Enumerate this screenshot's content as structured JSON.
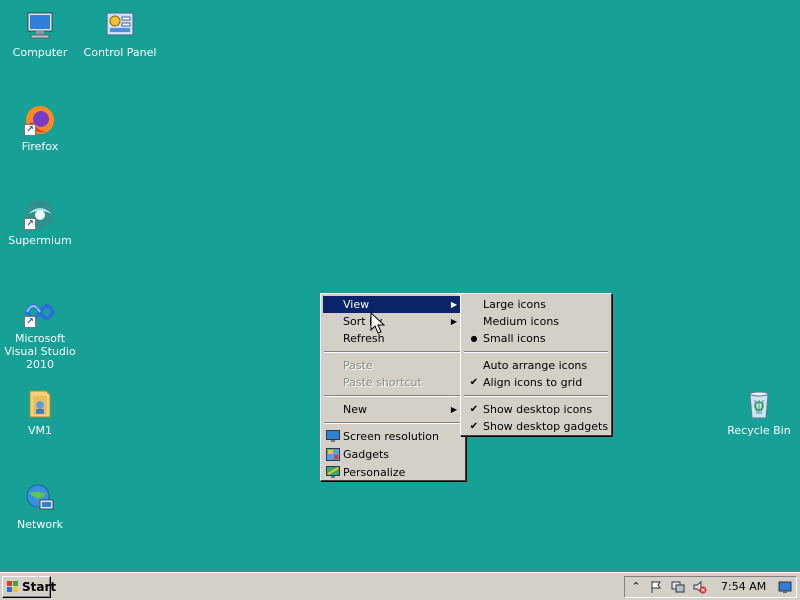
{
  "desktop": {
    "icons": [
      {
        "label": "Computer"
      },
      {
        "label": "Control Panel"
      },
      {
        "label": "Firefox"
      },
      {
        "label": "Supermium"
      },
      {
        "label": "Microsoft Visual Studio 2010"
      },
      {
        "label": "VM1"
      },
      {
        "label": "Network"
      },
      {
        "label": "Recycle Bin"
      }
    ],
    "background_color": "#16a096"
  },
  "context_menu": {
    "items": {
      "view": "View",
      "sort_by": "Sort by",
      "refresh": "Refresh",
      "paste": "Paste",
      "paste_shortcut": "Paste shortcut",
      "new": "New",
      "screen_resolution": "Screen resolution",
      "gadgets": "Gadgets",
      "personalize": "Personalize"
    },
    "selected": "View"
  },
  "view_submenu": {
    "large_icons": "Large icons",
    "medium_icons": "Medium icons",
    "small_icons": "Small icons",
    "auto_arrange": "Auto arrange icons",
    "align_to_grid": "Align icons to grid",
    "show_desktop_icons": "Show desktop icons",
    "show_desktop_gadgets": "Show desktop gadgets",
    "radio_selected": "Small icons",
    "checked": [
      "Align icons to grid",
      "Show desktop icons",
      "Show desktop gadgets"
    ],
    "bullet_glyph": "●",
    "check_glyph": "✔"
  },
  "taskbar": {
    "start_label": "Start",
    "clock": "7:54 AM",
    "tray_icons": [
      "show-hidden-icons",
      "action-center-flag",
      "network-icon",
      "volume-muted-icon",
      "show-desktop-icon"
    ]
  },
  "colors": {
    "menu_highlight": "#0a246a",
    "menu_face": "#d4d0c8"
  }
}
